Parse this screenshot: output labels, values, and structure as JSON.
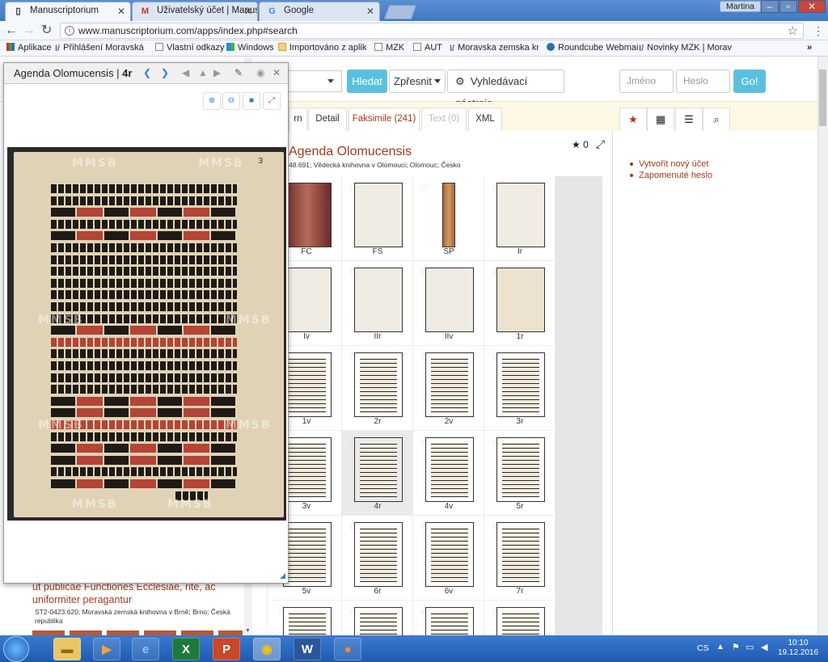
{
  "browser": {
    "tabs": [
      {
        "title": "Manuscriptorium",
        "icon": "document-icon"
      },
      {
        "title": "Uživatelský účet | Manus",
        "icon": "mail-icon"
      },
      {
        "title": "Google",
        "icon": "google-icon"
      }
    ],
    "user": "Martina",
    "url": "www.manuscriptorium.com/apps/index.php#search",
    "bookmarks": [
      "Aplikace",
      "Přihlášení  Moravská",
      "Vlastní odkazy",
      "Windows",
      "Importováno z aplikac",
      "MZK",
      "AUT",
      "Moravska zemska kni",
      "Roundcube Webmail",
      "Novinky MZK | Morav"
    ],
    "more_bookmarks": "»"
  },
  "search_bar": {
    "search_button": "Hledat",
    "refine_button": "Zpřesnit",
    "tools_button": "Vyhledávací nástroje",
    "username_placeholder": "Jméno",
    "password_placeholder": "Heslo",
    "go_button": "Go!"
  },
  "view_tabs": [
    "rn",
    "Detail",
    "Faksimile (241)",
    "Text (0)",
    "XML"
  ],
  "right_tabs": [
    "star-icon",
    "grid-icon",
    "list-icon",
    "search-icon"
  ],
  "right_tab_glyphs": [
    "★",
    "▦",
    "☰",
    "⌕"
  ],
  "document": {
    "title": "Agenda Olomucensis",
    "meta": "48.691; Vědecká knihovna v Olomouci; Olomouc; Česko",
    "rating": "0"
  },
  "account_links": [
    "Vytvořit nový účet",
    "Zapomenuté heslo"
  ],
  "thumbnails": [
    {
      "label": "FC",
      "kind": "brown"
    },
    {
      "label": "FS",
      "kind": "blank"
    },
    {
      "label": "SP",
      "kind": "spine"
    },
    {
      "label": "Ir",
      "kind": "blank"
    },
    {
      "label": "Iv",
      "kind": "blank"
    },
    {
      "label": "IIr",
      "kind": "blank"
    },
    {
      "label": "IIv",
      "kind": "blank"
    },
    {
      "label": "1r",
      "kind": "aged"
    },
    {
      "label": "1v",
      "kind": "text"
    },
    {
      "label": "2r",
      "kind": "text"
    },
    {
      "label": "2v",
      "kind": "text"
    },
    {
      "label": "3r",
      "kind": "text"
    },
    {
      "label": "3v",
      "kind": "text"
    },
    {
      "label": "4r",
      "kind": "text",
      "selected": true
    },
    {
      "label": "4v",
      "kind": "text"
    },
    {
      "label": "5r",
      "kind": "text"
    },
    {
      "label": "5v",
      "kind": "text"
    },
    {
      "label": "6r",
      "kind": "text"
    },
    {
      "label": "6v",
      "kind": "text"
    },
    {
      "label": "7r",
      "kind": "text"
    },
    {
      "label": "",
      "kind": "text"
    },
    {
      "label": "",
      "kind": "text"
    },
    {
      "label": "",
      "kind": "text"
    },
    {
      "label": "",
      "kind": "text"
    }
  ],
  "left_results": {
    "title": "ut publicae Functiones Ecclesiae, rite, ac uniformiter peragantur",
    "meta": "ST2-0423.620; Moravská zemská knihovna v Brně; Brno; Česká republika"
  },
  "viewer": {
    "title": "Agenda Olomucensis | ",
    "page": "4r",
    "page_number": "3",
    "watermark": "MMSB"
  },
  "taskbar": {
    "apps": [
      "explorer",
      "media-player",
      "internet-explorer",
      "excel",
      "powerpoint",
      "chrome",
      "word",
      "firefox"
    ],
    "language": "CS",
    "time": "10:10",
    "date": "19.12.2016"
  }
}
